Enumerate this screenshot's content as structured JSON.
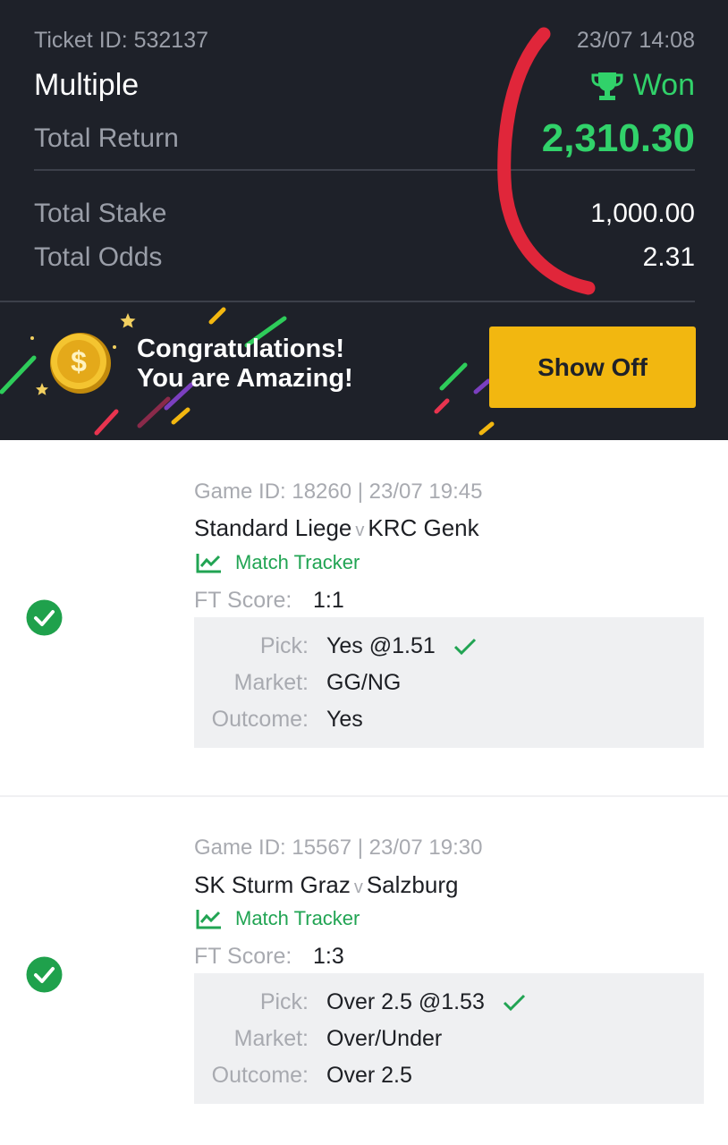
{
  "ticket": {
    "id_label": "Ticket ID: 532137",
    "datetime": "23/07 14:08",
    "type": "Multiple",
    "status": "Won",
    "total_return_label": "Total Return",
    "total_return_value": "2,310.30",
    "total_stake_label": "Total Stake",
    "total_stake_value": "1,000.00",
    "total_odds_label": "Total Odds",
    "total_odds_value": "2.31",
    "status_icon": "trophy-icon",
    "colors": {
      "background": "#1e2129",
      "won": "#31d26a",
      "accent": "#f2b710"
    }
  },
  "banner": {
    "line1": "Congratulations!",
    "line2": "You are Amazing!",
    "button_label": "Show Off",
    "coin_symbol": "$"
  },
  "games": [
    {
      "meta": "Game ID: 18260 | 23/07 19:45",
      "home": "Standard Liege",
      "vs": "v",
      "away": "KRC Genk",
      "tracker_label": "Match Tracker",
      "ft_score_label": "FT Score:",
      "ft_score_value": "1:1",
      "pick_label": "Pick:",
      "pick_value": "Yes @1.51",
      "market_label": "Market:",
      "market_value": "GG/NG",
      "outcome_label": "Outcome:",
      "outcome_value": "Yes"
    },
    {
      "meta": "Game ID: 15567 | 23/07 19:30",
      "home": "SK Sturm Graz",
      "vs": "v",
      "away": "Salzburg",
      "tracker_label": "Match Tracker",
      "ft_score_label": "FT Score:",
      "ft_score_value": "1:3",
      "pick_label": "Pick:",
      "pick_value": "Over 2.5 @1.53",
      "market_label": "Market:",
      "market_value": "Over/Under",
      "outcome_label": "Outcome:",
      "outcome_value": "Over 2.5"
    }
  ]
}
